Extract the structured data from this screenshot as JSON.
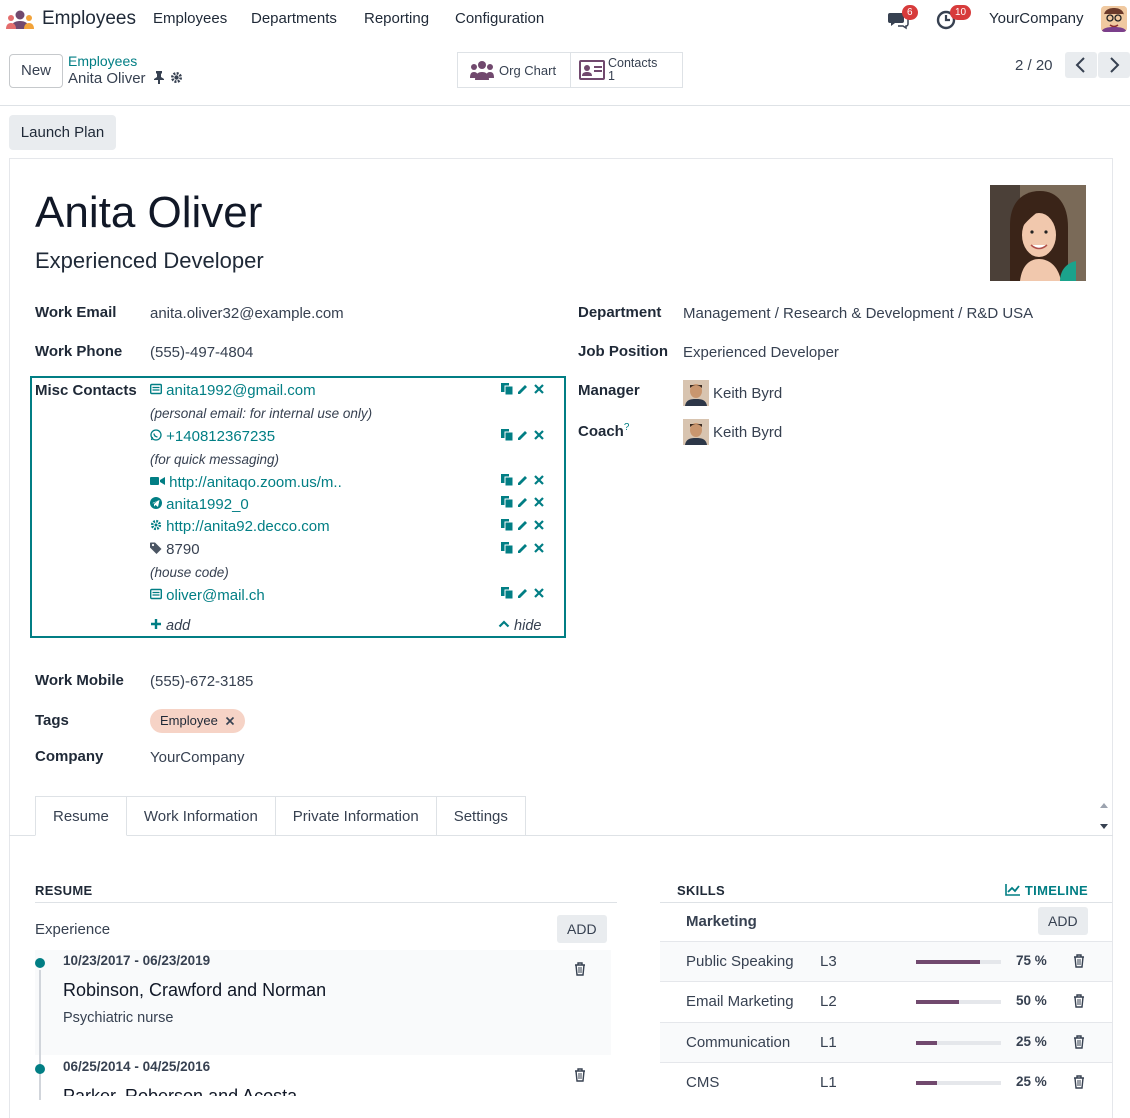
{
  "topbar": {
    "app_name": "Employees",
    "menu": [
      "Employees",
      "Departments",
      "Reporting",
      "Configuration"
    ],
    "messages_count": "6",
    "activities_count": "10",
    "company": "YourCompany"
  },
  "control": {
    "new_label": "New",
    "breadcrumb_parent": "Employees",
    "breadcrumb_current": "Anita Oliver",
    "org_chart_label": "Org Chart",
    "contacts_label": "Contacts",
    "contacts_count": "1",
    "pager": "2 / 20"
  },
  "launch_plan_label": "Launch Plan",
  "employee": {
    "name": "Anita Oliver",
    "job_title": "Experienced Developer"
  },
  "fields": {
    "work_email_label": "Work Email",
    "work_email": "anita.oliver32@example.com",
    "work_phone_label": "Work Phone",
    "work_phone": "(555)-497-4804",
    "misc_label": "Misc Contacts",
    "work_mobile_label": "Work Mobile",
    "work_mobile": "(555)-672-3185",
    "tags_label": "Tags",
    "tag": "Employee",
    "company_label": "Company",
    "company": "YourCompany",
    "department_label": "Department",
    "department": "Management / Research & Development / R&D USA",
    "job_position_label": "Job Position",
    "job_position": "Experienced Developer",
    "manager_label": "Manager",
    "manager": "Keith Byrd",
    "coach_label": "Coach",
    "coach_help": "?",
    "coach": "Keith Byrd"
  },
  "misc": {
    "c1": "anita1992@gmail.com",
    "c1_note": "(personal email: for internal use only)",
    "c2": "+140812367235",
    "c2_note": "(for quick messaging)",
    "c3": "http://anitaqo.zoom.us/m..",
    "c4": "anita1992_0",
    "c5": "http://anita92.decco.com",
    "c6": "8790",
    "c6_note": "(house code)",
    "c7": "oliver@mail.ch",
    "add": "add",
    "hide": "hide"
  },
  "tabs": [
    "Resume",
    "Work Information",
    "Private Information",
    "Settings"
  ],
  "resume": {
    "heading": "RESUME",
    "section": "Experience",
    "add": "ADD",
    "items": [
      {
        "dates": "10/23/2017 - 06/23/2019",
        "company": "Robinson, Crawford and Norman",
        "role": "Psychiatric nurse"
      },
      {
        "dates": "06/25/2014 - 04/25/2016",
        "company": "Parker, Roberson and Acosta",
        "role": ""
      }
    ]
  },
  "skills": {
    "heading": "SKILLS",
    "timeline": "TIMELINE",
    "group": "Marketing",
    "add": "ADD",
    "items": [
      {
        "name": "Public Speaking",
        "level": "L3",
        "pct": "75 %",
        "fill": 0.75
      },
      {
        "name": "Email Marketing",
        "level": "L2",
        "pct": "50 %",
        "fill": 0.5
      },
      {
        "name": "Communication",
        "level": "L1",
        "pct": "25 %",
        "fill": 0.25
      },
      {
        "name": "CMS",
        "level": "L1",
        "pct": "25 %",
        "fill": 0.25
      }
    ]
  },
  "colors": {
    "accent": "#017e84",
    "skill_bar": "#71496e",
    "badge": "#d73b3b"
  }
}
